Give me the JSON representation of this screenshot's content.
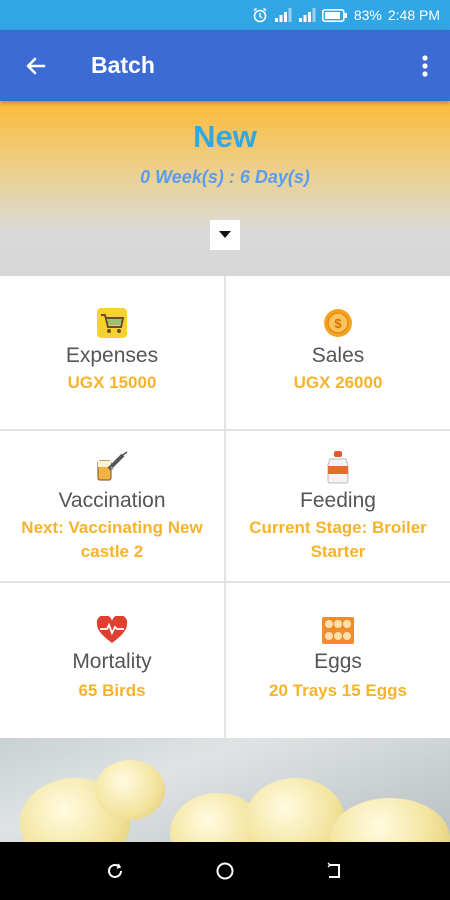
{
  "status_bar": {
    "battery": "83%",
    "time": "2:48 PM",
    "icons": [
      "alarm-icon",
      "signal-icon",
      "signal-icon",
      "battery-icon"
    ]
  },
  "app_bar": {
    "title": "Batch",
    "back_icon": "arrow-left-icon",
    "menu_icon": "more-vert-icon"
  },
  "batch": {
    "status": "New",
    "age": "0 Week(s) : 6 Day(s)",
    "dropdown_icon": "caret-down-icon"
  },
  "tiles": {
    "expenses": {
      "label": "Expenses",
      "value": "UGX 15000",
      "icon": "cart-icon"
    },
    "sales": {
      "label": "Sales",
      "value": "UGX 26000",
      "icon": "coins-icon"
    },
    "vaccination": {
      "label": "Vaccination",
      "value": "Next: Vaccinating New castle 2",
      "icon": "syringe-icon"
    },
    "feeding": {
      "label": "Feeding",
      "value": "Current Stage: Broiler Starter",
      "icon": "feed-bottle-icon"
    },
    "mortality": {
      "label": "Mortality",
      "value": "65 Birds",
      "icon": "heartbeat-icon"
    },
    "eggs": {
      "label": "Eggs",
      "value": "20 Trays 15 Eggs",
      "icon": "egg-tray-icon"
    }
  },
  "colors": {
    "status_bar": "#32a5e4",
    "app_bar": "#3d6bd4",
    "accent": "#f7b32b",
    "status_text": "#33a7e0"
  },
  "nav_bar": {
    "icons": [
      "recent-apps-icon",
      "home-icon",
      "back-icon"
    ]
  }
}
